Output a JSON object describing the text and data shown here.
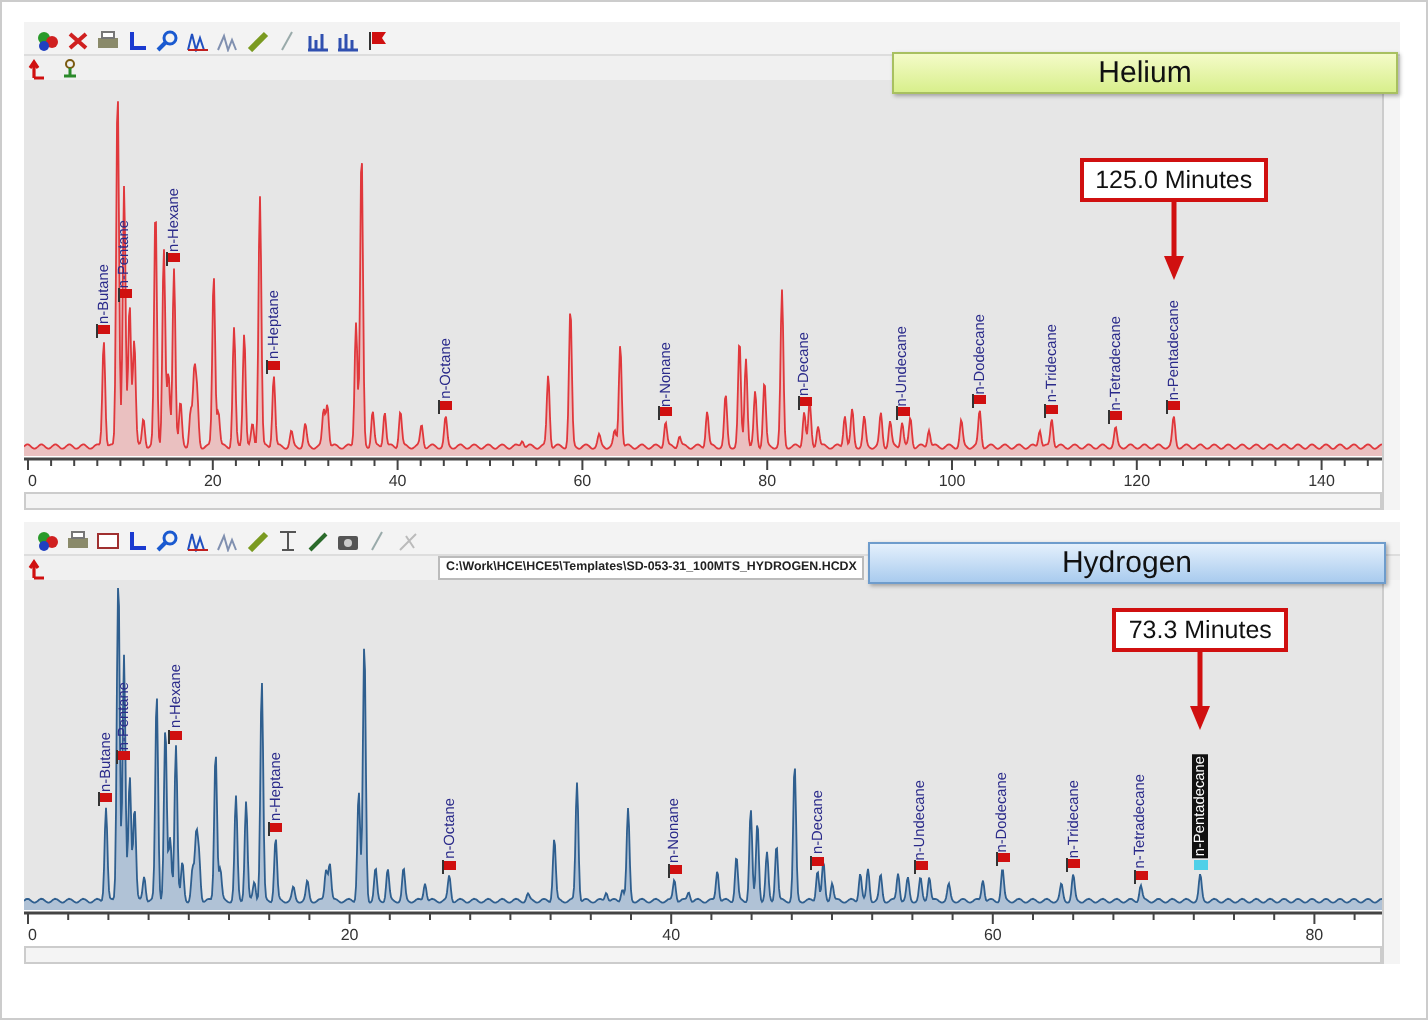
{
  "panels": [
    {
      "kind": "helium",
      "title": "Helium",
      "x_ticks": [
        "0",
        "20",
        "40",
        "60",
        "80",
        "100",
        "120",
        "140"
      ],
      "peaks": [
        {
          "label": "n-Butane",
          "selected": false
        },
        {
          "label": "n-Pentane",
          "selected": false
        },
        {
          "label": "n-Hexane",
          "selected": false
        },
        {
          "label": "n-Heptane",
          "selected": false
        },
        {
          "label": "n-Octane",
          "selected": false
        },
        {
          "label": "n-Nonane",
          "selected": false
        },
        {
          "label": "n-Decane",
          "selected": false
        },
        {
          "label": "n-Undecane",
          "selected": false
        },
        {
          "label": "n-Dodecane",
          "selected": false
        },
        {
          "label": "n-Tridecane",
          "selected": false
        },
        {
          "label": "n-Tetradecane",
          "selected": false
        },
        {
          "label": "n-Pentadecane",
          "selected": false,
          "callout": "125.0 Minutes"
        }
      ]
    },
    {
      "kind": "hydrogen",
      "title": "Hydrogen",
      "file_path": "C:\\Work\\HCE\\HCE5\\Templates\\SD-053-31_100MTS_HYDROGEN.HCDX",
      "x_ticks": [
        "0",
        "20",
        "40",
        "60",
        "80"
      ],
      "peaks": [
        {
          "label": "n-Butane",
          "selected": false
        },
        {
          "label": "n-Pentane",
          "selected": false
        },
        {
          "label": "n-Hexane",
          "selected": false
        },
        {
          "label": "n-Heptane",
          "selected": false
        },
        {
          "label": "n-Octane",
          "selected": false
        },
        {
          "label": "n-Nonane",
          "selected": false
        },
        {
          "label": "n-Decane",
          "selected": false
        },
        {
          "label": "n-Undecane",
          "selected": false
        },
        {
          "label": "n-Dodecane",
          "selected": false
        },
        {
          "label": "n-Tridecane",
          "selected": false
        },
        {
          "label": "n-Tetradecane",
          "selected": false
        },
        {
          "label": "n-Pentadecane",
          "selected": true,
          "callout": "73.3 Minutes"
        }
      ]
    }
  ]
}
